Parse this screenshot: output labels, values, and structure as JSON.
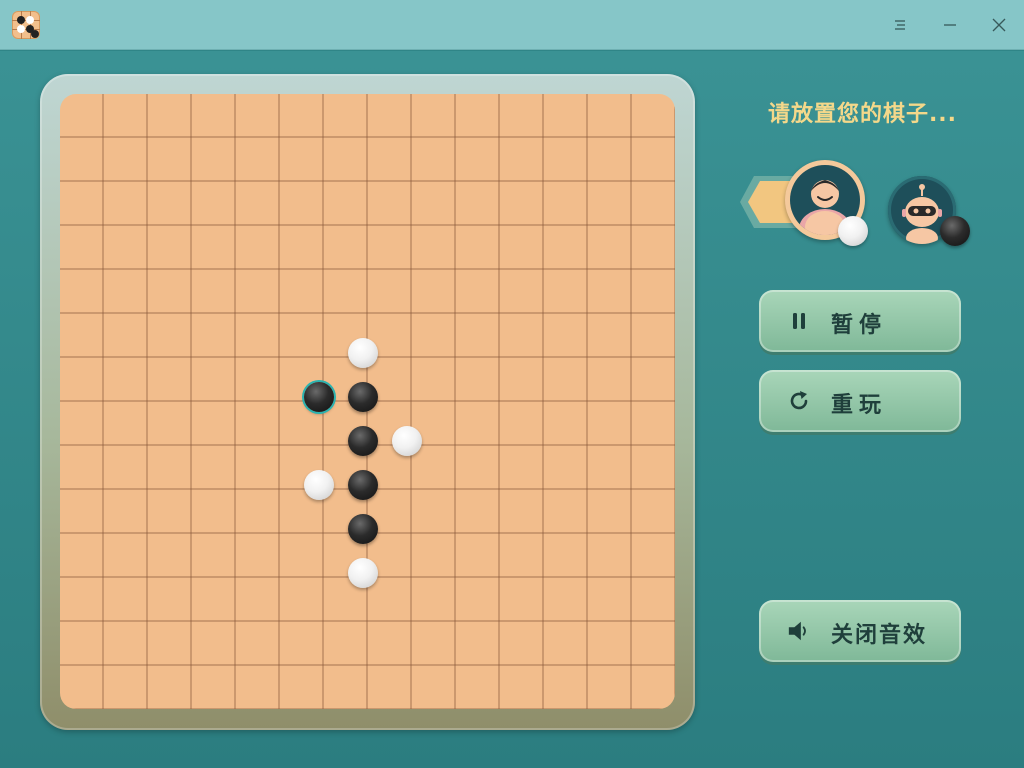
{
  "window": {
    "app_icon": "gomoku-board-icon",
    "controls": [
      "menu-icon",
      "minimize-icon",
      "close-icon"
    ]
  },
  "game": {
    "status_text": "请放置您的棋子...",
    "board_size": 15,
    "current_turn": "player",
    "player_stone": "white",
    "ai_stone": "black",
    "last_move": [
      6,
      5
    ],
    "stones": [
      {
        "color": "white",
        "row": 5,
        "col": 6
      },
      {
        "color": "black",
        "row": 6,
        "col": 5
      },
      {
        "color": "black",
        "row": 6,
        "col": 6
      },
      {
        "color": "black",
        "row": 7,
        "col": 6
      },
      {
        "color": "white",
        "row": 7,
        "col": 7
      },
      {
        "color": "white",
        "row": 8,
        "col": 5
      },
      {
        "color": "black",
        "row": 8,
        "col": 6
      },
      {
        "color": "black",
        "row": 9,
        "col": 6
      },
      {
        "color": "white",
        "row": 10,
        "col": 6
      }
    ]
  },
  "players": {
    "human": {
      "avatar": "player-avatar-icon",
      "stone": "white"
    },
    "ai": {
      "avatar": "robot-avatar-icon",
      "stone": "black"
    }
  },
  "buttons": {
    "pause": {
      "label": "暂停",
      "icon": "pause-icon"
    },
    "replay": {
      "label": "重玩",
      "icon": "replay-icon"
    },
    "sound": {
      "label": "关闭音效",
      "icon": "speaker-icon"
    }
  },
  "colors": {
    "background": "#2f8587",
    "titlebar": "#86c6c8",
    "board": "#f2bd8c",
    "grid_line": "#8a5a3c",
    "status_text": "#f4d88a",
    "button": "#9acbb0",
    "last_move_ring": "#2bb3b0"
  }
}
